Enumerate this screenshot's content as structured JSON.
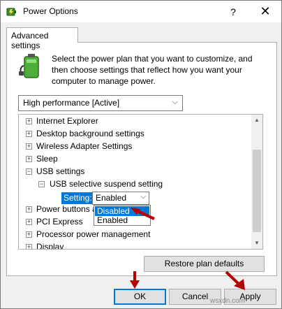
{
  "window": {
    "title": "Power Options",
    "help_glyph": "?",
    "close_glyph": "✕"
  },
  "tab": {
    "label": "Advanced settings"
  },
  "intro": {
    "text": "Select the power plan that you want to customize, and then choose settings that reflect how you want your computer to manage power."
  },
  "plan_select": {
    "value": "High performance [Active]",
    "chevron": "⌵"
  },
  "tree": {
    "items": [
      {
        "label": "Internet Explorer",
        "expander": "+"
      },
      {
        "label": "Desktop background settings",
        "expander": "+"
      },
      {
        "label": "Wireless Adapter Settings",
        "expander": "+"
      },
      {
        "label": "Sleep",
        "expander": "+"
      },
      {
        "label": "USB settings",
        "expander": "−"
      },
      {
        "label": "USB selective suspend setting",
        "expander": "−"
      },
      {
        "label": "Power buttons and lid",
        "expander": "+"
      },
      {
        "label": "PCI Express",
        "expander": "+"
      },
      {
        "label": "Processor power management",
        "expander": "+"
      },
      {
        "label": "Display",
        "expander": "+"
      }
    ],
    "setting_label": "Setting:",
    "setting_value": "Enabled",
    "setting_chevron": "⌵",
    "dropdown_options": [
      "Disabled",
      "Enabled"
    ],
    "dropdown_selected": "Disabled"
  },
  "buttons": {
    "restore": "Restore plan defaults",
    "ok": "OK",
    "cancel": "Cancel",
    "apply": "Apply"
  },
  "watermark": "wsxdn.com",
  "colors": {
    "accent": "#0078d7",
    "arrow": "#b40000"
  }
}
